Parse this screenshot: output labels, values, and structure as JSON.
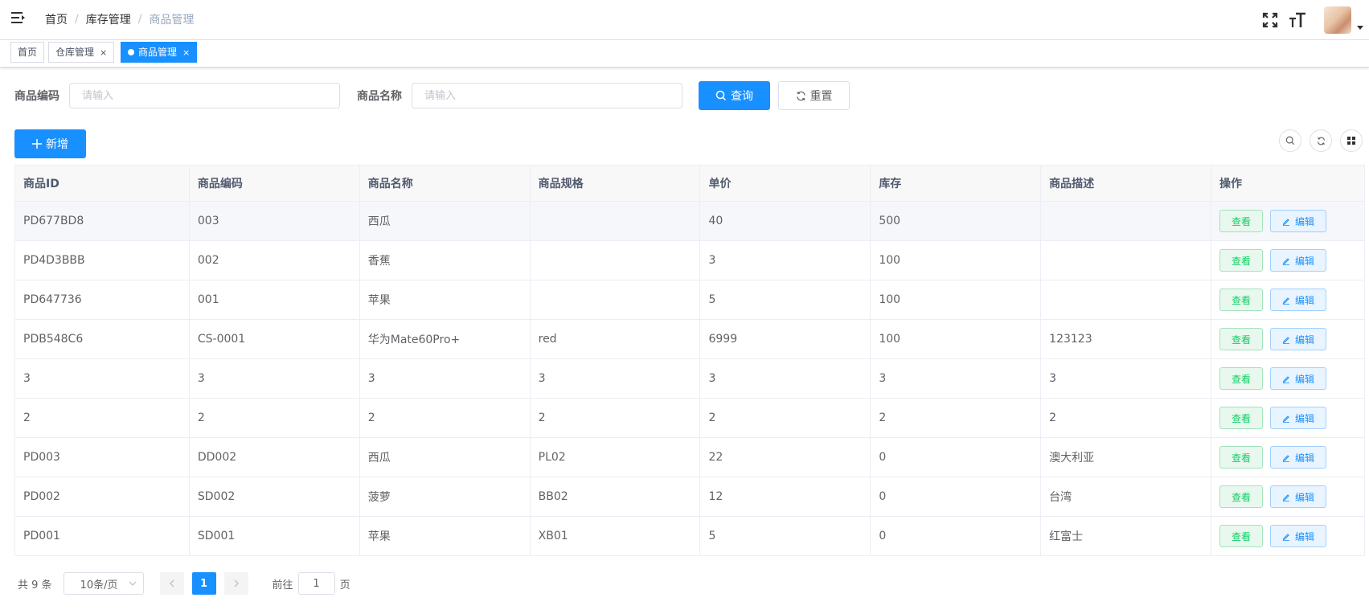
{
  "navbar": {
    "breadcrumb": [
      "首页",
      "库存管理",
      "商品管理"
    ],
    "breadcrumb_sep": "/",
    "icons": [
      "menu-fold-icon",
      "fullscreen-icon",
      "font-size-icon",
      "avatar",
      "caret-down-icon"
    ]
  },
  "tags": [
    {
      "label": "首页",
      "active": false
    },
    {
      "label": "仓库管理",
      "active": false,
      "closable": true
    },
    {
      "label": "商品管理",
      "active": true,
      "closable": true
    }
  ],
  "tag_close": "×",
  "search": {
    "code_label": "商品编码",
    "code_placeholder": "请输入",
    "name_label": "商品名称",
    "name_placeholder": "请输入",
    "query_label": "查询",
    "reset_label": "重置"
  },
  "toolbar": {
    "add_label": "新增",
    "right_icons": [
      "search-icon",
      "refresh-icon",
      "columns-icon"
    ]
  },
  "table": {
    "columns": [
      "商品ID",
      "商品编码",
      "商品名称",
      "商品规格",
      "单价",
      "库存",
      "商品描述",
      "操作"
    ],
    "rows": [
      [
        "PD677BD8",
        "003",
        "西瓜",
        "",
        "40",
        "500",
        ""
      ],
      [
        "PD4D3BBB",
        "002",
        "香蕉",
        "",
        "3",
        "100",
        ""
      ],
      [
        "PD647736",
        "001",
        "苹果",
        "",
        "5",
        "100",
        ""
      ],
      [
        "PDB548C6",
        "CS-0001",
        "华为Mate60Pro+",
        "red",
        "6999",
        "100",
        "123123"
      ],
      [
        "3",
        "3",
        "3",
        "3",
        "3",
        "3",
        "3"
      ],
      [
        "2",
        "2",
        "2",
        "2",
        "2",
        "2",
        "2"
      ],
      [
        "PD003",
        "DD002",
        "西瓜",
        "PL02",
        "22",
        "0",
        "澳大利亚"
      ],
      [
        "PD002",
        "SD002",
        "菠萝",
        "BB02",
        "12",
        "0",
        "台湾"
      ],
      [
        "PD001",
        "SD001",
        "苹果",
        "XB01",
        "5",
        "0",
        "红富士"
      ]
    ],
    "view_label": "查看",
    "edit_label": "编辑"
  },
  "pagination": {
    "total_text": "共 9 条",
    "page_size": "10条/页",
    "current_page": "1",
    "goto_label": "前往",
    "goto_value": "1",
    "page_suffix": "页"
  },
  "colors": {
    "primary": "#1890ff",
    "success": "#13ce66"
  }
}
